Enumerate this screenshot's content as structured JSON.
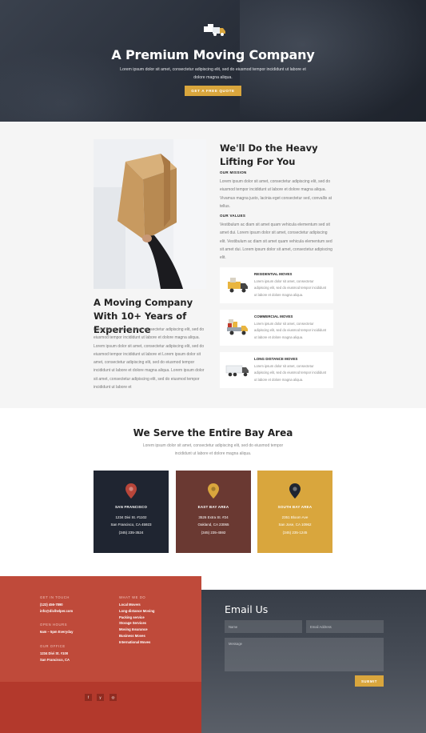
{
  "hero": {
    "title": "A Premium Moving Company",
    "text": "Lorem ipsum dolor sit amet, consectetur adipiscing elit, sed do eiusmod tempor incididunt ut labore et dolore magna aliqua.",
    "button": "GET A FREE QUOTE",
    "logo_icon": "moving-truck-icon"
  },
  "about": {
    "left_heading": "A Moving Company With 10+ Years of Experience",
    "left_text": "Lorem ipsum dolor sit amet, consectetur adipiscing elit, sed do eiusmod tempor incididunt ut labore et dolore magna aliqua. Lorem ipsum dolor sit amet, consectetur adipiscing elit, sed do eiusmod tempor incididunt ut labore et Lorem ipsum dolor sit amet, consectetur adipiscing elit, sed do eiusmod tempor incididunt ut labore et dolore magna aliqua. Lorem ipsum dolor sit amet, consectetur adipiscing elit, sed do eiusmod tempor incididunt ut labore et",
    "right_heading": "We'll Do the Heavy Lifting For You",
    "mission_label": "OUR MISSION",
    "mission_text": "Lorem ipsum dolor sit amet, consectetur adipiscing elit, sed do eiusmod tempor incididunt ut labore et dolore magna aliqua. Vivamus magna justo, lacinia eget consectetur sed, convallis at tellus.",
    "values_label": "OUR VALUES",
    "values_text": "Vestibulum ac diam sit amet quam vehicula elementum sed sit amet dui. Lorem ipsum dolor sit amet, consectetur adipiscing elit. Vestibulum ac diam sit amet quam vehicula elementum sed sit amet dui. Lorem ipsum dolor sit amet, consectetur adipiscing elit.",
    "services": [
      {
        "title": "RESIDENTIAL MOVES",
        "text": "Lorem ipsum dolor sit amet, consectetur adipiscing elit, sed do eiusmod tempor incididunt ut labore et dolore magna aliqua.",
        "icon": "moving-van-icon"
      },
      {
        "title": "COMMERCIAL MOVES",
        "text": "Lorem ipsum dolor sit amet, consectetur adipiscing elit, sed do eiusmod tempor incididunt ut labore et dolore magna aliqua.",
        "icon": "loaded-truck-icon"
      },
      {
        "title": "LONG DISTANCE MOVES",
        "text": "Lorem ipsum dolor sit amet, consectetur adipiscing elit, sed do eiusmod tempor incididunt ut labore et dolore magna aliqua.",
        "icon": "semi-truck-icon"
      }
    ]
  },
  "serve": {
    "heading": "We Serve the Entire Bay Area",
    "text": "Lorem ipsum dolor sit amet, consectetur adipiscing elit, sed do eiusmod tempor incididunt ut labore et dolore magna aliqua.",
    "cards": [
      {
        "title": "SAN FRANCISCO",
        "address1": "1234 Divi St. #1102",
        "address2": "San Francisco, CA 45923",
        "phone": "(345) 235-3524",
        "bg": "#1f2531",
        "pin": "#b8463a"
      },
      {
        "title": "EAST BAY AREA",
        "address1": "3526 Extra St. #24",
        "address2": "Oakland, CA 23065",
        "phone": "(345) 235-4592",
        "bg": "#6a3932",
        "pin": "#d9a63d"
      },
      {
        "title": "SOUTH BAY AREA",
        "address1": "2351 Bloom Ave",
        "address2": "San Jose, CA 10962",
        "phone": "(345) 235-1245",
        "bg": "#d9a63d",
        "pin": "#1f2531"
      }
    ]
  },
  "footer": {
    "touch_label": "GET IN TOUCH",
    "phone": "(123) 456-7890",
    "email": "info@divihelper.com",
    "hours_label": "OPEN HOURS",
    "hours": "6am – 5pm Everyday",
    "office_label": "OUR OFFICE",
    "office1": "1234 Divi St. #100",
    "office2": "San Francisco, CA",
    "what_label": "WHAT WE DO",
    "services": [
      "Local Movers",
      "Long-distance Moving",
      "Packing service",
      "Storage Services",
      "Moving Insurance",
      "Business Moves",
      "International Moves"
    ],
    "social": [
      {
        "icon": "facebook-icon",
        "glyph": "f"
      },
      {
        "icon": "twitter-icon",
        "glyph": "y"
      },
      {
        "icon": "instagram-icon",
        "glyph": "◎"
      }
    ],
    "form": {
      "heading": "Email Us",
      "name_placeholder": "Name",
      "email_placeholder": "Email Address",
      "message_placeholder": "Message",
      "submit": "SUBMIT"
    }
  }
}
